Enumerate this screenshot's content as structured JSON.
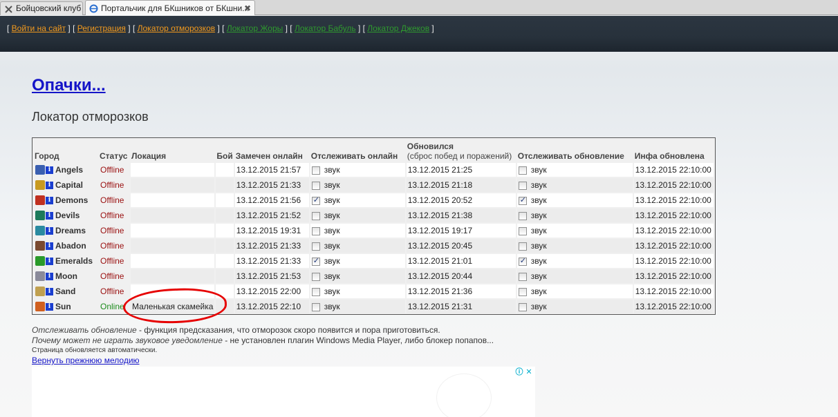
{
  "tabs": [
    {
      "label": "Бойцовский клуб",
      "icon": "close-x-icon"
    },
    {
      "label": "Портальчик для БКшников от БКшни...",
      "icon": "ie-icon"
    }
  ],
  "nav": {
    "items": [
      {
        "label": "Войти на сайт",
        "color": "#f29a1e"
      },
      {
        "label": "Регистрация",
        "color": "#f29a1e"
      },
      {
        "label": "Локатор отморозков",
        "color": "#f29a1e"
      },
      {
        "label": "Локатор Жоры",
        "color": "#2f9a2f"
      },
      {
        "label": "Локатор Бабуль",
        "color": "#2f9a2f"
      },
      {
        "label": "Локатор Джеков",
        "color": "#2f9a2f"
      }
    ]
  },
  "page": {
    "title": "Опачки...",
    "subtitle": "Локатор отморозков"
  },
  "table": {
    "headers": {
      "city": "Город",
      "status": "Статус",
      "location": "Локация",
      "fight": "Бой",
      "seen": "Замечен онлайн",
      "track_online": "Отслеживать онлайн",
      "updated": "Обновился",
      "updated_sub": "(сброс побед и поражений)",
      "track_update": "Отслеживать обновление",
      "info_updated": "Инфа обновлена"
    },
    "sound_label": "звук",
    "rows": [
      {
        "city": "Angels",
        "icon_color": "#3a5fb0",
        "status": "Offline",
        "online": false,
        "location": "",
        "fight": "",
        "seen": "13.12.2015 21:57",
        "track_online": false,
        "updated": "13.12.2015 21:25",
        "track_update": false,
        "info_updated": "13.12.2015 22:10:00"
      },
      {
        "city": "Capital",
        "icon_color": "#c89a20",
        "status": "Offline",
        "online": false,
        "location": "",
        "fight": "",
        "seen": "13.12.2015 21:33",
        "track_online": false,
        "updated": "13.12.2015 21:18",
        "track_update": false,
        "info_updated": "13.12.2015 22:10:00"
      },
      {
        "city": "Demons",
        "icon_color": "#c03020",
        "status": "Offline",
        "online": false,
        "location": "",
        "fight": "",
        "seen": "13.12.2015 21:56",
        "track_online": true,
        "updated": "13.12.2015 20:52",
        "track_update": true,
        "info_updated": "13.12.2015 22:10:00"
      },
      {
        "city": "Devils",
        "icon_color": "#1d7a5a",
        "status": "Offline",
        "online": false,
        "location": "",
        "fight": "",
        "seen": "13.12.2015 21:52",
        "track_online": false,
        "updated": "13.12.2015 21:38",
        "track_update": false,
        "info_updated": "13.12.2015 22:10:00"
      },
      {
        "city": "Dreams",
        "icon_color": "#2a8aa0",
        "status": "Offline",
        "online": false,
        "location": "",
        "fight": "",
        "seen": "13.12.2015 19:31",
        "track_online": false,
        "updated": "13.12.2015 19:17",
        "track_update": false,
        "info_updated": "13.12.2015 22:10:00"
      },
      {
        "city": "Abadon",
        "icon_color": "#7a4a30",
        "status": "Offline",
        "online": false,
        "location": "",
        "fight": "",
        "seen": "13.12.2015 21:33",
        "track_online": false,
        "updated": "13.12.2015 20:45",
        "track_update": false,
        "info_updated": "13.12.2015 22:10:00"
      },
      {
        "city": "Emeralds",
        "icon_color": "#2a9a2a",
        "status": "Offline",
        "online": false,
        "location": "",
        "fight": "",
        "seen": "13.12.2015 21:33",
        "track_online": true,
        "updated": "13.12.2015 21:01",
        "track_update": true,
        "info_updated": "13.12.2015 22:10:00"
      },
      {
        "city": "Moon",
        "icon_color": "#8a8a9a",
        "status": "Offline",
        "online": false,
        "location": "",
        "fight": "",
        "seen": "13.12.2015 21:53",
        "track_online": false,
        "updated": "13.12.2015 20:44",
        "track_update": false,
        "info_updated": "13.12.2015 22:10:00"
      },
      {
        "city": "Sand",
        "icon_color": "#c0a050",
        "status": "Offline",
        "online": false,
        "location": "",
        "fight": "",
        "seen": "13.12.2015 22:00",
        "track_online": false,
        "updated": "13.12.2015 21:36",
        "track_update": false,
        "info_updated": "13.12.2015 22:10:00"
      },
      {
        "city": "Sun",
        "icon_color": "#d06020",
        "status": "Online",
        "online": true,
        "location": "Маленькая скамейка",
        "fight": "",
        "seen": "13.12.2015 22:10",
        "track_online": false,
        "updated": "13.12.2015 21:31",
        "track_update": false,
        "info_updated": "13.12.2015 22:10:00"
      }
    ]
  },
  "notes": {
    "line1_em": "Отслеживать обновление",
    "line1_rest": " - функция предсказания, что отморозок скоро появится и пора приготовиться.",
    "line2_em": "Почему может не играть звуковое уведомление",
    "line2_rest": " - не установлен плагин Windows Media Player, либо блокер попапов...",
    "auto_refresh": "Страница обновляется автоматически.",
    "restore_link": "Вернуть прежнюю мелодию"
  },
  "ad": {
    "info_icon": "info-icon",
    "close_icon": "close-icon"
  }
}
